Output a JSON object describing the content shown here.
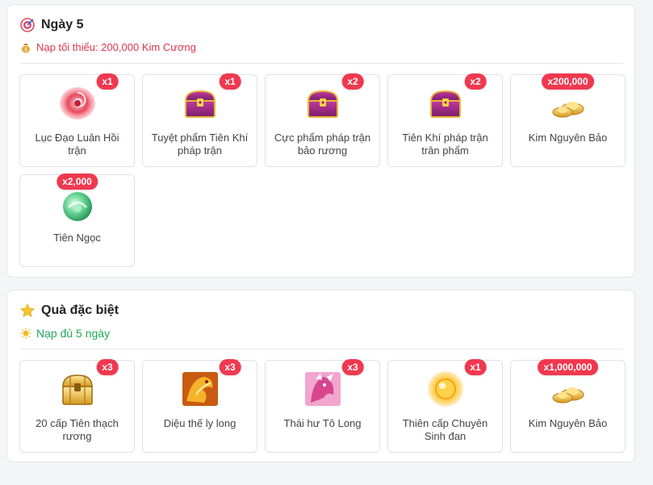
{
  "day_section": {
    "title": "Ngày 5",
    "subtitle": "Nạp tối thiểu: 200,000 Kim Cương",
    "items": [
      {
        "name": "Lục Đạo Luân Hồi trận",
        "qty": "x1",
        "icon": "red-swirl-icon"
      },
      {
        "name": "Tuyệt phẩm Tiên Khí pháp trận",
        "qty": "x1",
        "icon": "treasure-chest-icon"
      },
      {
        "name": "Cực phẩm pháp trận bảo rương",
        "qty": "x2",
        "icon": "treasure-chest-icon"
      },
      {
        "name": "Tiên Khí pháp trận trân phẩm",
        "qty": "x2",
        "icon": "treasure-chest-icon"
      },
      {
        "name": "Kim Nguyên Bảo",
        "qty": "x200,000",
        "icon": "gold-ingot-icon"
      },
      {
        "name": "Tiên Ngọc",
        "qty": "x2,000",
        "icon": "jade-orb-icon"
      }
    ]
  },
  "special_section": {
    "title": "Quà đặc biệt",
    "subtitle": "Nạp đủ 5 ngày",
    "items": [
      {
        "name": "20 cấp Tiên thạch rương",
        "qty": "x3",
        "icon": "gold-chest-icon"
      },
      {
        "name": "Diệu thế ly long",
        "qty": "x3",
        "icon": "golden-dragon-icon"
      },
      {
        "name": "Thái hư Tô Long",
        "qty": "x3",
        "icon": "pink-dragon-icon"
      },
      {
        "name": "Thiên cấp Chuyên Sinh đan",
        "qty": "x1",
        "icon": "golden-pill-icon"
      },
      {
        "name": "Kim Nguyên Bảo",
        "qty": "x1,000,000",
        "icon": "gold-ingot-icon"
      }
    ]
  },
  "colors": {
    "badge": "#f0384f",
    "subtitle_red": "#e0344b",
    "subtitle_green": "#1faa59"
  }
}
